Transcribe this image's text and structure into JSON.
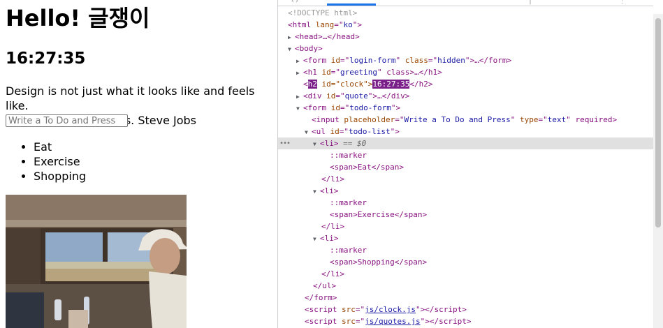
{
  "page": {
    "greeting": "Hello! 글쟁이",
    "clock": "16:27:35",
    "quote_text": "Design is not just what it looks like and feels like.",
    "quote_line2": "Design is how it works. Steve Jobs",
    "todo_placeholder": "Write a To Do and Press",
    "todos": [
      "Eat",
      "Exercise",
      "Shopping"
    ],
    "photo_icon": "person-in-window-photo"
  },
  "devtools": {
    "accent_color": "#1a73e8",
    "lines": {
      "doctype": "<!DOCTYPE html>",
      "html_open": "<html lang=\"ko\">",
      "head": "<head>…</head>",
      "body_open": "<body>",
      "login_form": "<form id=\"login-form\" class=\"hidden\">…</form>",
      "h1": "<h1 id=\"greeting\" class>…</h1>",
      "h2_tag": "h2",
      "h2_attr": " id=\"clock\">",
      "h2_value": "16:27:35",
      "h2_close": "</h2>",
      "quote_div": "<div id=\"quote\">…</div>",
      "todo_form": "<form id=\"todo-form\">",
      "input": "<input placeholder=\"Write a To Do and Press\" type=\"text\" required>",
      "ul": "<ul id=\"todo-list\">",
      "li_open": "<li>",
      "li_eq": " == $0",
      "marker": "::marker",
      "span_eat": "<span>Eat</span>",
      "li_close": "</li>",
      "span_exercise": "<span>Exercise</span>",
      "span_shopping": "<span>Shopping</span>",
      "ul_close": "</ul>",
      "form_close": "</form>",
      "script_clock": "js/clock.js",
      "script_quotes": "js/quotes.js",
      "row_menu": "•••"
    }
  }
}
